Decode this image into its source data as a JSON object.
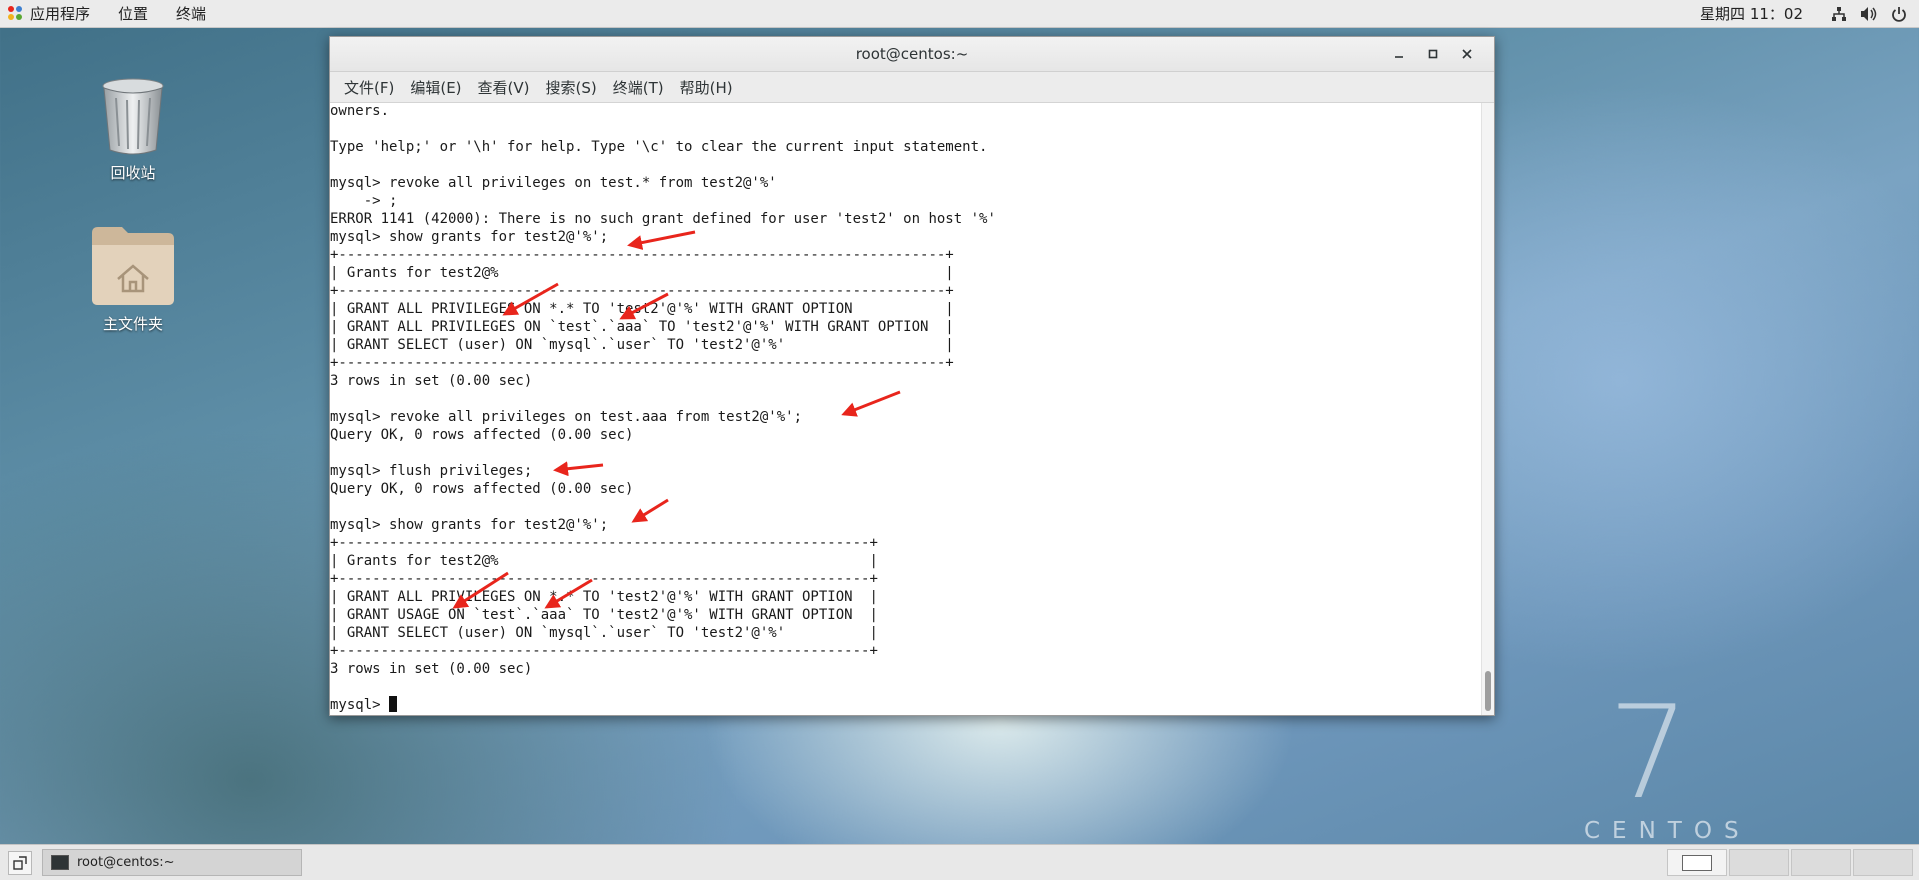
{
  "top_panel": {
    "menu": [
      "应用程序",
      "位置",
      "终端"
    ],
    "clock": "星期四 11：02",
    "tray_icons": [
      "network-icon",
      "volume-icon",
      "power-icon"
    ]
  },
  "desktop": {
    "icons": [
      {
        "label": "回收站",
        "icon": "trash-icon"
      },
      {
        "label": "主文件夹",
        "icon": "home-folder-icon"
      }
    ],
    "brand_number": "7",
    "brand_word": "CENTOS"
  },
  "window": {
    "title": "root@centos:~",
    "controls": {
      "minimize": "–",
      "maximize": "□",
      "close": "✕"
    },
    "menu": [
      "文件(F)",
      "编辑(E)",
      "查看(V)",
      "搜索(S)",
      "终端(T)",
      "帮助(H)"
    ],
    "terminal_lines": [
      "owners.",
      "",
      "Type 'help;' or '\\h' for help. Type '\\c' to clear the current input statement.",
      "",
      "mysql> revoke all privileges on test.* from test2@'%'",
      "    -> ;",
      "ERROR 1141 (42000): There is no such grant defined for user 'test2' on host '%'",
      "mysql> show grants for test2@'%';",
      "+------------------------------------------------------------------------+",
      "| Grants for test2@%                                                     |",
      "+------------------------------------------------------------------------+",
      "| GRANT ALL PRIVILEGES ON *.* TO 'test2'@'%' WITH GRANT OPTION           |",
      "| GRANT ALL PRIVILEGES ON `test`.`aaa` TO 'test2'@'%' WITH GRANT OPTION  |",
      "| GRANT SELECT (user) ON `mysql`.`user` TO 'test2'@'%'                   |",
      "+------------------------------------------------------------------------+",
      "3 rows in set (0.00 sec)",
      "",
      "mysql> revoke all privileges on test.aaa from test2@'%';",
      "Query OK, 0 rows affected (0.00 sec)",
      "",
      "mysql> flush privileges;",
      "Query OK, 0 rows affected (0.00 sec)",
      "",
      "mysql> show grants for test2@'%';",
      "+---------------------------------------------------------------+",
      "| Grants for test2@%                                            |",
      "+---------------------------------------------------------------+",
      "| GRANT ALL PRIVILEGES ON *.* TO 'test2'@'%' WITH GRANT OPTION  |",
      "| GRANT USAGE ON `test`.`aaa` TO 'test2'@'%' WITH GRANT OPTION  |",
      "| GRANT SELECT (user) ON `mysql`.`user` TO 'test2'@'%'          |",
      "+---------------------------------------------------------------+",
      "3 rows in set (0.00 sec)",
      ""
    ],
    "prompt": "mysql> "
  },
  "taskbar": {
    "task_label": "root@centos:~",
    "workspace_count": 4
  },
  "colors": {
    "annotation_arrow": "#e8251c",
    "panel": "#ebebeb",
    "terminal_bg": "#ffffff",
    "terminal_fg": "#1a1a1a"
  }
}
